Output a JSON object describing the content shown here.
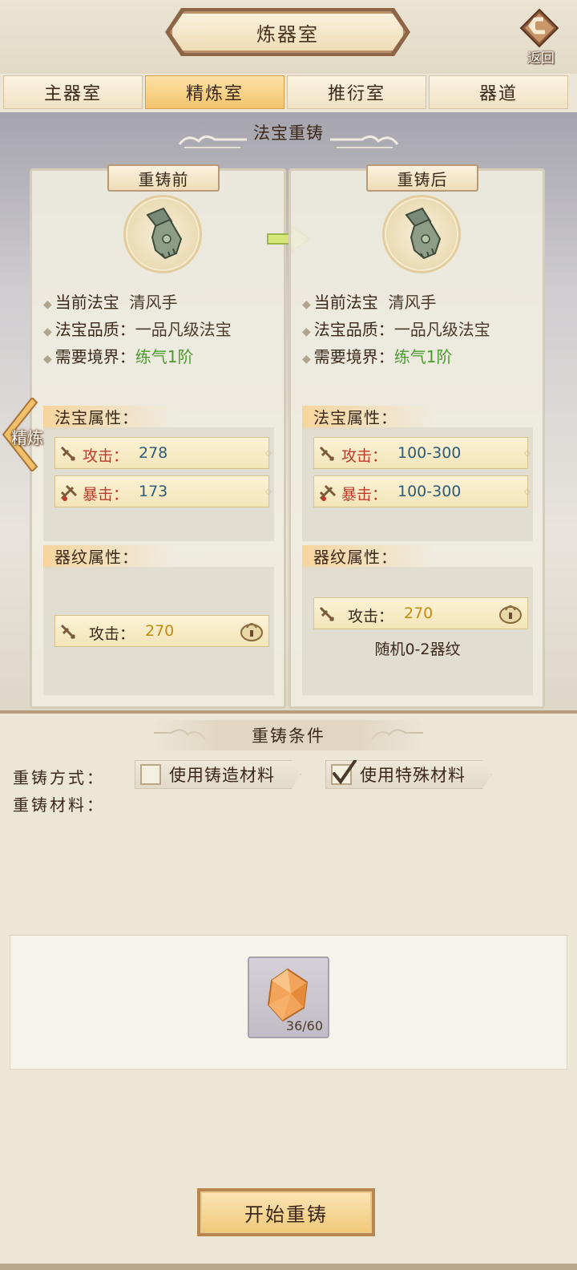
{
  "header": {
    "title": "炼器室",
    "back_label": "返回"
  },
  "tabs": [
    {
      "label": "主器室",
      "active": false
    },
    {
      "label": "精炼室",
      "active": true
    },
    {
      "label": "推衍室",
      "active": false
    },
    {
      "label": "器道",
      "active": false
    }
  ],
  "side_tab": {
    "label": "精炼"
  },
  "recast": {
    "section_title": "法宝重铸",
    "before": {
      "heading": "重铸前",
      "item_icon": "jade-gauntlet",
      "current_label": "当前法宝",
      "current_value": "清风手",
      "quality_label": "法宝品质：",
      "quality_value": "一品凡级法宝",
      "realm_label": "需要境界：",
      "realm_value": "练气1阶",
      "attr_title": "法宝属性：",
      "attrs": [
        {
          "icon": "sword-icon",
          "label": "攻击：",
          "value": "278"
        },
        {
          "icon": "crit-icon",
          "label": "暴击：",
          "value": "173"
        }
      ],
      "pattern_title": "器纹属性：",
      "patterns": [
        {
          "icon": "sword-icon",
          "label": "攻击：",
          "value": "270",
          "lock_icon": "lock-icon"
        }
      ]
    },
    "after": {
      "heading": "重铸后",
      "item_icon": "jade-gauntlet",
      "current_label": "当前法宝",
      "current_value": "清风手",
      "quality_label": "法宝品质：",
      "quality_value": "一品凡级法宝",
      "realm_label": "需要境界：",
      "realm_value": "练气1阶",
      "attr_title": "法宝属性：",
      "attrs": [
        {
          "icon": "sword-icon",
          "label": "攻击：",
          "value": "100-300"
        },
        {
          "icon": "crit-icon",
          "label": "暴击：",
          "value": "100-300"
        }
      ],
      "pattern_title": "器纹属性：",
      "patterns": [
        {
          "icon": "sword-icon",
          "label": "攻击：",
          "value": "270",
          "lock_icon": "lock-icon"
        }
      ],
      "random_note": "随机0-2器纹"
    }
  },
  "conditions": {
    "title": "重铸条件",
    "method_label": "重铸方式：",
    "material_label": "重铸材料：",
    "options": [
      {
        "label": "使用铸造材料",
        "checked": false
      },
      {
        "label": "使用特殊材料",
        "checked": true
      }
    ],
    "material": {
      "icon": "orange-crystal",
      "count": "36/60"
    },
    "start_button": "开始重铸"
  },
  "colors": {
    "attr_label": "#c0392b",
    "attr_value_blue": "#2c5b7a",
    "pattern_value_gold": "#c48b12",
    "realm_green": "#4c9a2e",
    "active_tab": "#f3c46d"
  }
}
